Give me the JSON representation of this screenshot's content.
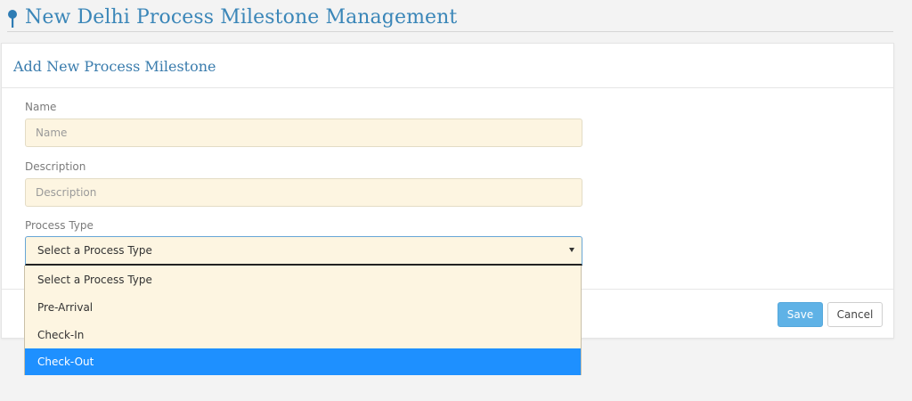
{
  "page": {
    "title": "New Delhi Process Milestone Management",
    "title_icon": "map-pin-icon"
  },
  "panel": {
    "title": "Add New Process Milestone"
  },
  "form": {
    "name": {
      "label": "Name",
      "placeholder": "Name",
      "value": ""
    },
    "description": {
      "label": "Description",
      "placeholder": "Description",
      "value": ""
    },
    "process_type": {
      "label": "Process Type",
      "selected": "Select a Process Type",
      "options": [
        "Select a Process Type",
        "Pre-Arrival",
        "Check-In",
        "Check-Out"
      ],
      "highlighted_option": "Check-Out"
    }
  },
  "footer": {
    "save_label": "Save",
    "cancel_label": "Cancel"
  },
  "colors": {
    "title": "#3a86b8",
    "input_background": "#fdf5e1",
    "save_button": "#5fb2e6",
    "highlight": "#1e90ff"
  }
}
